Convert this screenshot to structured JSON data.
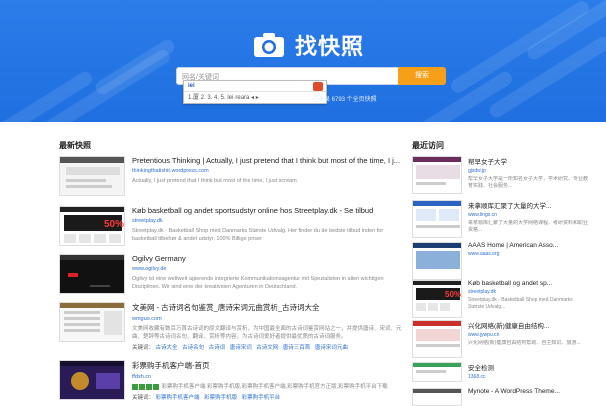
{
  "logo": {
    "text": "找快照",
    "icon": "camera-icon"
  },
  "search": {
    "placeholder": "网名/关键词",
    "button_label": "搜索",
    "count_text": "已收录 6793 个全页快照",
    "ime": {
      "typed": "iei",
      "candidates": "1.厦  2.  3.  4.  5.  lei·reara  ◂ ▸"
    }
  },
  "latest": {
    "heading": "最新快照",
    "items": [
      {
        "title": "Pretentious Thinking | Actually, I just pretend that I think but most of the time, I j...",
        "url": "thinkingthatishit.wordpress.com",
        "desc": "Actually, I just pretend that I think but most of the time, I just scream."
      },
      {
        "title": "Køb basketball og andet sportsudstyr online hos Streetplay.dk - Se tilbud",
        "url": "streetplay.dk",
        "desc": "Streetplay.dk - Basketball Shop med Danmarks Største Udvalg. Her finder du de bedste tilbud inden for basketball tilbehør & andet udstyr. 100% Billige priser"
      },
      {
        "title": "Ogilvy Germany",
        "url": "www.ogilvy.de",
        "desc": "Ogilvy ist eine weltweit agierende integrierte Kommunikationsagentur mit Spezialisten in allen wichtigen Disziplinen. Wir sind eine der kreativsten Agenturen in Deutschland."
      },
      {
        "title": "文美网 - 古诗词名句鉴赏_唐诗宋词元曲赏析_古诗词大全",
        "url": "wmguo.com",
        "desc": "文美网收藏有数百万首古诗词的原文翻译与赏析，为中国最全面的古诗词鉴赏网站之一，并提供唐诗、宋词、元曲、楚辞等古诗词名句、翻译、赏析等内容，为古诗词爱好者提供最优质的古诗词服务。",
        "keywords_label": "关键词：",
        "keywords": [
          "古诗大全",
          "古诗名句",
          "古诗词",
          "唐诗宋词",
          "古诗文网",
          "唐诗三百首",
          "唐诗宋词元曲"
        ]
      },
      {
        "title": "彩票购手机客户端-首页",
        "url": "ffdsh.cn",
        "desc": "彩票购手机客户端 彩票购手机版,彩票购手机客户端,彩票购手机官方正版,彩票购手机平台下载",
        "keywords_label": "关键词：",
        "keywords": [
          "彩票购手机客户端",
          "彩票购手机版",
          "彩票购手机平台"
        ]
      }
    ]
  },
  "recent": {
    "heading": "最近访问",
    "items": [
      {
        "title": "帮早女子大学",
        "url": "gjsdw.jp",
        "desc": "帮早女子大学是一所知名女子大学，学术研究、专业教育实践、社会服务..."
      },
      {
        "title": "来拿顺库汇聚了大量的大学...",
        "url": "www.lingx.cn",
        "desc": "来拿顺库汇聚了大量的大学网络课程、考研资料和职业资格..."
      },
      {
        "title": "AAAS Home | American Asso...",
        "url": "www.aaas.org",
        "desc": ""
      },
      {
        "title": "Køb basketball og andet sp...",
        "url": "streetplay.dk",
        "desc": "Streetplay.dk - Basketball Shop med Danmarks Største Udvalg..."
      },
      {
        "title": "兴化网络(新)健康自由结构...",
        "url": "www.jywpu.cn",
        "desc": "兴化网络(新)健康自由结构帮助、自主知识、旅游..."
      },
      {
        "title": "安全检测",
        "url": "1368.cc",
        "desc": ""
      },
      {
        "title": "Mynote - A WordPress Theme...",
        "url": "",
        "desc": ""
      }
    ]
  },
  "colors": {
    "hero": "#2176e6",
    "accent": "#f6a01a",
    "link": "#2c6fd6"
  }
}
